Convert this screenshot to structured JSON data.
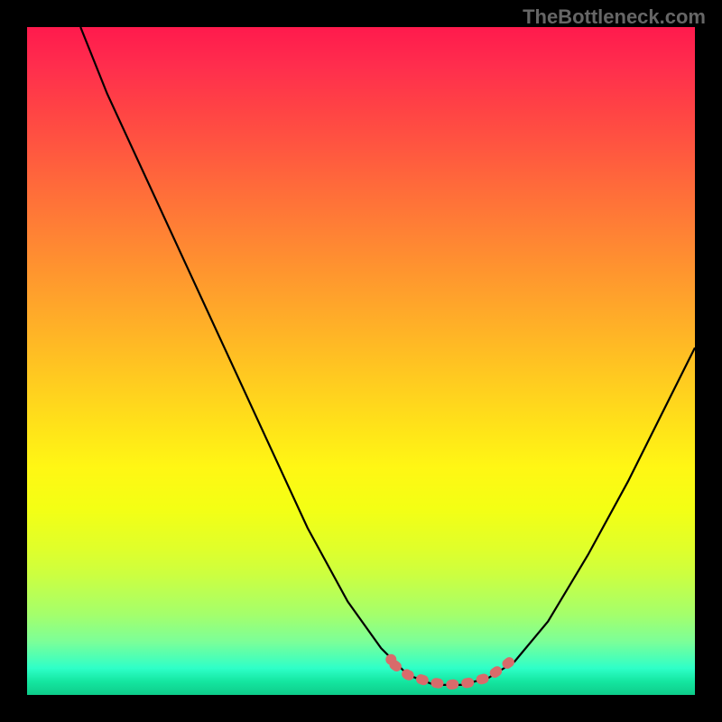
{
  "watermark": "TheBottleneck.com",
  "chart_data": {
    "type": "line",
    "title": "",
    "xlabel": "",
    "ylabel": "",
    "xlim": [
      0,
      100
    ],
    "ylim": [
      0,
      100
    ],
    "grid": false,
    "series": [
      {
        "name": "bottleneck-curve",
        "color": "#000000",
        "points": [
          {
            "x": 8,
            "y": 100
          },
          {
            "x": 12,
            "y": 90
          },
          {
            "x": 18,
            "y": 77
          },
          {
            "x": 24,
            "y": 64
          },
          {
            "x": 30,
            "y": 51
          },
          {
            "x": 36,
            "y": 38
          },
          {
            "x": 42,
            "y": 25
          },
          {
            "x": 48,
            "y": 14
          },
          {
            "x": 53,
            "y": 7
          },
          {
            "x": 57,
            "y": 3
          },
          {
            "x": 61,
            "y": 1.5
          },
          {
            "x": 65,
            "y": 1.5
          },
          {
            "x": 69,
            "y": 2.5
          },
          {
            "x": 73,
            "y": 5
          },
          {
            "x": 78,
            "y": 11
          },
          {
            "x": 84,
            "y": 21
          },
          {
            "x": 90,
            "y": 32
          },
          {
            "x": 96,
            "y": 44
          },
          {
            "x": 100,
            "y": 52
          }
        ]
      },
      {
        "name": "highlighted-flat-region",
        "color": "#d86b6b",
        "style": "thick-dashed",
        "points": [
          {
            "x": 55,
            "y": 4.5
          },
          {
            "x": 57,
            "y": 3
          },
          {
            "x": 60,
            "y": 2
          },
          {
            "x": 63,
            "y": 1.5
          },
          {
            "x": 66,
            "y": 1.8
          },
          {
            "x": 69,
            "y": 2.6
          },
          {
            "x": 71,
            "y": 4
          },
          {
            "x": 73,
            "y": 5.5
          }
        ]
      }
    ],
    "annotations": []
  }
}
